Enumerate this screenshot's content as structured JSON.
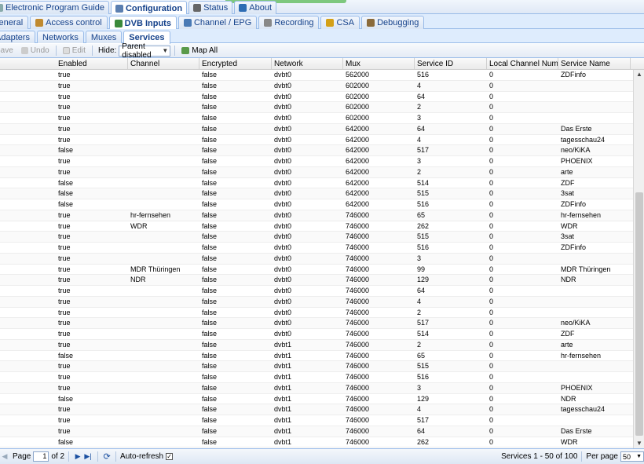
{
  "main_tabs": [
    {
      "label": "Electronic Program Guide",
      "icon": "epg-icon",
      "active": false
    },
    {
      "label": "Configuration",
      "icon": "wrench-icon",
      "active": true
    },
    {
      "label": "Status",
      "icon": "status-icon",
      "active": false
    },
    {
      "label": "About",
      "icon": "info-icon",
      "active": false
    }
  ],
  "config_tabs": [
    {
      "label": "General",
      "icon": "",
      "active": false
    },
    {
      "label": "Access control",
      "icon": "users-icon",
      "active": false
    },
    {
      "label": "DVB Inputs",
      "icon": "dvb-icon",
      "active": true
    },
    {
      "label": "Channel / EPG",
      "icon": "tv-icon",
      "active": false
    },
    {
      "label": "Recording",
      "icon": "recorder-icon",
      "active": false
    },
    {
      "label": "CSA",
      "icon": "key-icon",
      "active": false
    },
    {
      "label": "Debugging",
      "icon": "bug-icon",
      "active": false
    }
  ],
  "dvb_tabs": [
    {
      "label": "Adapters",
      "active": false
    },
    {
      "label": "Networks",
      "active": false
    },
    {
      "label": "Muxes",
      "active": false
    },
    {
      "label": "Services",
      "active": true
    }
  ],
  "toolbar": {
    "save_label": "Save",
    "undo_label": "Undo",
    "edit_label": "Edit",
    "hide_label": "Hide:",
    "hide_value": "Parent disabled",
    "mapall_label": "Map All"
  },
  "columns": [
    "Enabled",
    "Channel",
    "Encrypted",
    "Network",
    "Mux",
    "Service ID",
    "Local Channel Number",
    "Service Name"
  ],
  "rows": [
    [
      "true",
      "",
      "false",
      "dvbt0",
      "562000",
      "516",
      "0",
      "ZDFinfo"
    ],
    [
      "true",
      "",
      "false",
      "dvbt0",
      "602000",
      "4",
      "0",
      ""
    ],
    [
      "true",
      "",
      "false",
      "dvbt0",
      "602000",
      "64",
      "0",
      ""
    ],
    [
      "true",
      "",
      "false",
      "dvbt0",
      "602000",
      "2",
      "0",
      ""
    ],
    [
      "true",
      "",
      "false",
      "dvbt0",
      "602000",
      "3",
      "0",
      ""
    ],
    [
      "true",
      "",
      "false",
      "dvbt0",
      "642000",
      "64",
      "0",
      "Das Erste"
    ],
    [
      "true",
      "",
      "false",
      "dvbt0",
      "642000",
      "4",
      "0",
      "tagesschau24"
    ],
    [
      "false",
      "",
      "false",
      "dvbt0",
      "642000",
      "517",
      "0",
      "neo/KiKA"
    ],
    [
      "true",
      "",
      "false",
      "dvbt0",
      "642000",
      "3",
      "0",
      "PHOENIX"
    ],
    [
      "true",
      "",
      "false",
      "dvbt0",
      "642000",
      "2",
      "0",
      "arte"
    ],
    [
      "false",
      "",
      "false",
      "dvbt0",
      "642000",
      "514",
      "0",
      "ZDF"
    ],
    [
      "false",
      "",
      "false",
      "dvbt0",
      "642000",
      "515",
      "0",
      "3sat"
    ],
    [
      "false",
      "",
      "false",
      "dvbt0",
      "642000",
      "516",
      "0",
      "ZDFinfo"
    ],
    [
      "true",
      "hr-fernsehen",
      "false",
      "dvbt0",
      "746000",
      "65",
      "0",
      "hr-fernsehen"
    ],
    [
      "true",
      "WDR",
      "false",
      "dvbt0",
      "746000",
      "262",
      "0",
      "WDR"
    ],
    [
      "true",
      "",
      "false",
      "dvbt0",
      "746000",
      "515",
      "0",
      "3sat"
    ],
    [
      "true",
      "",
      "false",
      "dvbt0",
      "746000",
      "516",
      "0",
      "ZDFinfo"
    ],
    [
      "true",
      "",
      "false",
      "dvbt0",
      "746000",
      "3",
      "0",
      ""
    ],
    [
      "true",
      "MDR Thüringen",
      "false",
      "dvbt0",
      "746000",
      "99",
      "0",
      "MDR Thüringen"
    ],
    [
      "true",
      "NDR",
      "false",
      "dvbt0",
      "746000",
      "129",
      "0",
      "NDR"
    ],
    [
      "true",
      "",
      "false",
      "dvbt0",
      "746000",
      "64",
      "0",
      ""
    ],
    [
      "true",
      "",
      "false",
      "dvbt0",
      "746000",
      "4",
      "0",
      ""
    ],
    [
      "true",
      "",
      "false",
      "dvbt0",
      "746000",
      "2",
      "0",
      ""
    ],
    [
      "true",
      "",
      "false",
      "dvbt0",
      "746000",
      "517",
      "0",
      "neo/KiKA"
    ],
    [
      "true",
      "",
      "false",
      "dvbt0",
      "746000",
      "514",
      "0",
      "ZDF"
    ],
    [
      "true",
      "",
      "false",
      "dvbt1",
      "746000",
      "2",
      "0",
      "arte"
    ],
    [
      "false",
      "",
      "false",
      "dvbt1",
      "746000",
      "65",
      "0",
      "hr-fernsehen"
    ],
    [
      "true",
      "",
      "false",
      "dvbt1",
      "746000",
      "515",
      "0",
      ""
    ],
    [
      "true",
      "",
      "false",
      "dvbt1",
      "746000",
      "516",
      "0",
      ""
    ],
    [
      "true",
      "",
      "false",
      "dvbt1",
      "746000",
      "3",
      "0",
      "PHOENIX"
    ],
    [
      "false",
      "",
      "false",
      "dvbt1",
      "746000",
      "129",
      "0",
      "NDR"
    ],
    [
      "true",
      "",
      "false",
      "dvbt1",
      "746000",
      "4",
      "0",
      "tagesschau24"
    ],
    [
      "true",
      "",
      "false",
      "dvbt1",
      "746000",
      "517",
      "0",
      ""
    ],
    [
      "true",
      "",
      "false",
      "dvbt1",
      "746000",
      "64",
      "0",
      "Das Erste"
    ],
    [
      "false",
      "",
      "false",
      "dvbt1",
      "746000",
      "262",
      "0",
      "WDR"
    ]
  ],
  "pager": {
    "page_label": "Page",
    "page_value": "1",
    "of_label": "of 2",
    "autorefresh_label": "Auto-refresh",
    "autorefresh_check": "✓",
    "summary": "Services 1 - 50 of 100",
    "per_page_label": "Per page",
    "per_page_value": "50"
  }
}
